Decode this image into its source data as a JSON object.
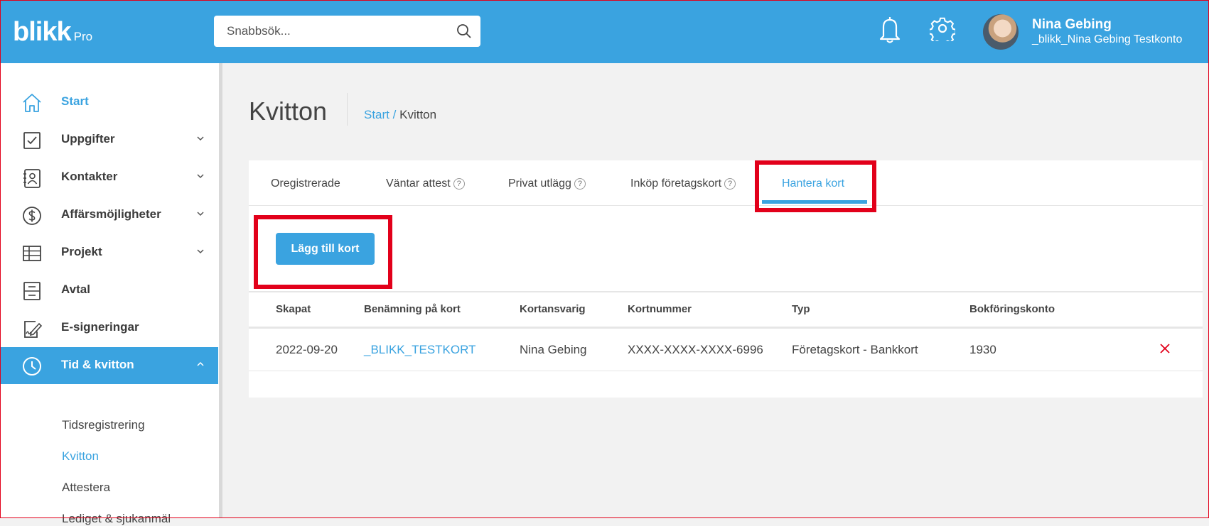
{
  "header": {
    "logo": "blikk",
    "logo_suffix": "Pro",
    "search_placeholder": "Snabbsök...",
    "user_name": "Nina Gebing",
    "user_account": "_blikk_Nina Gebing Testkonto"
  },
  "sidebar": {
    "items": [
      {
        "label": "Start",
        "icon": "home-icon",
        "state": "active"
      },
      {
        "label": "Uppgifter",
        "icon": "checkbox-icon",
        "expandable": true
      },
      {
        "label": "Kontakter",
        "icon": "contact-book-icon",
        "expandable": true
      },
      {
        "label": "Affärsmöjligheter",
        "icon": "dollar-icon",
        "expandable": true
      },
      {
        "label": "Projekt",
        "icon": "table-icon",
        "expandable": true
      },
      {
        "label": "Avtal",
        "icon": "contract-icon"
      },
      {
        "label": "E-signeringar",
        "icon": "signature-icon"
      },
      {
        "label": "Tid & kvitton",
        "icon": "clock-icon",
        "state": "selected",
        "expanded": true
      }
    ],
    "sub_items": [
      "Tidsregistrering",
      "Kvitton",
      "Attestera",
      "Lediget & sjukanmäl"
    ]
  },
  "page": {
    "title": "Kvitton",
    "breadcrumb_root": "Start",
    "breadcrumb_sep": "/",
    "breadcrumb_current": "Kvitton"
  },
  "tabs": [
    {
      "label": "Oregistrerade",
      "help": false
    },
    {
      "label": "Väntar attest",
      "help": true
    },
    {
      "label": "Privat utlägg",
      "help": true
    },
    {
      "label": "Inköp företagskort",
      "help": true
    },
    {
      "label": "Hantera kort",
      "help": false,
      "active": true
    }
  ],
  "add_button_label": "Lägg till kort",
  "table": {
    "columns": [
      "Skapat",
      "Benämning på kort",
      "Kortansvarig",
      "Kortnummer",
      "Typ",
      "Bokföringskonto"
    ],
    "rows": [
      [
        "2022-09-20",
        "_BLIKK_TESTKORT",
        "Nina Gebing",
        "XXXX-XXXX-XXXX-6996",
        "Företagskort - Bankkort",
        "1930"
      ]
    ]
  },
  "colors": {
    "accent": "#3aa3e0",
    "highlight": "#e2001a",
    "delete": "#e2001a"
  }
}
